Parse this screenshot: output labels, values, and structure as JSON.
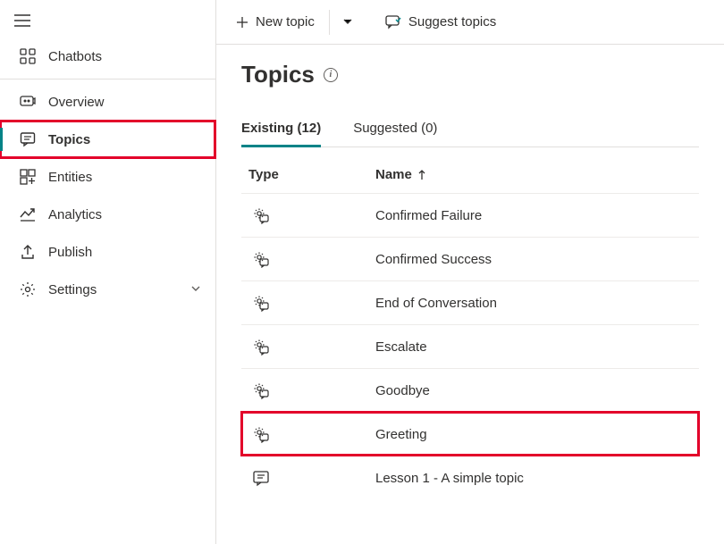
{
  "sidebar": {
    "chatbots": "Chatbots",
    "overview": "Overview",
    "topics": "Topics",
    "entities": "Entities",
    "analytics": "Analytics",
    "publish": "Publish",
    "settings": "Settings"
  },
  "cmdbar": {
    "new_topic": "New topic",
    "suggest_topics": "Suggest topics"
  },
  "page": {
    "title": "Topics"
  },
  "tabs": {
    "existing": "Existing (12)",
    "suggested": "Suggested (0)"
  },
  "table": {
    "header_type": "Type",
    "header_name": "Name",
    "rows": [
      {
        "name": "Confirmed Failure",
        "system": true
      },
      {
        "name": "Confirmed Success",
        "system": true
      },
      {
        "name": "End of Conversation",
        "system": true
      },
      {
        "name": "Escalate",
        "system": true
      },
      {
        "name": "Goodbye",
        "system": true
      },
      {
        "name": "Greeting",
        "system": true,
        "highlight": true
      },
      {
        "name": "Lesson 1 - A simple topic",
        "system": false
      }
    ]
  }
}
